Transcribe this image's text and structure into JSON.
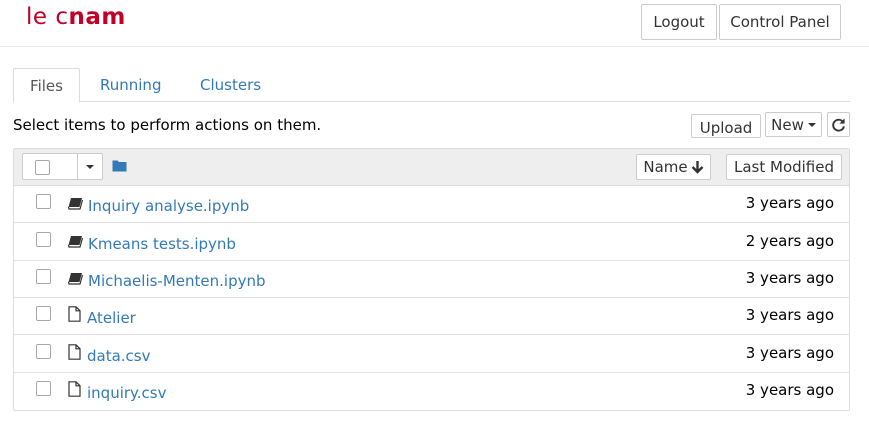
{
  "brand": {
    "logo_light": "le c",
    "logo_bold": "nam",
    "color": "#c1002a"
  },
  "header": {
    "logout_label": "Logout",
    "control_panel_label": "Control Panel"
  },
  "tabs": [
    {
      "label": "Files",
      "active": true
    },
    {
      "label": "Running",
      "active": false
    },
    {
      "label": "Clusters",
      "active": false
    }
  ],
  "toolbar": {
    "hint": "Select items to perform actions on them.",
    "upload_label": "Upload",
    "new_label": "New",
    "refresh_icon": "refresh-icon"
  },
  "list_header": {
    "folder_icon": "folder-icon",
    "name_label": "Name",
    "sort_icon": "arrow-down-icon",
    "modified_label": "Last Modified"
  },
  "files": [
    {
      "name": "Inquiry analyse.ipynb",
      "type": "notebook",
      "modified": "3 years ago"
    },
    {
      "name": "Kmeans tests.ipynb",
      "type": "notebook",
      "modified": "2 years ago"
    },
    {
      "name": "Michaelis-Menten.ipynb",
      "type": "notebook",
      "modified": "3 years ago"
    },
    {
      "name": "Atelier",
      "type": "file",
      "modified": "3 years ago"
    },
    {
      "name": "data.csv",
      "type": "file",
      "modified": "3 years ago"
    },
    {
      "name": "inquiry.csv",
      "type": "file",
      "modified": "3 years ago"
    }
  ],
  "colors": {
    "link": "#337ab7",
    "border": "#dddddd",
    "header_bg": "#eeeeee"
  }
}
